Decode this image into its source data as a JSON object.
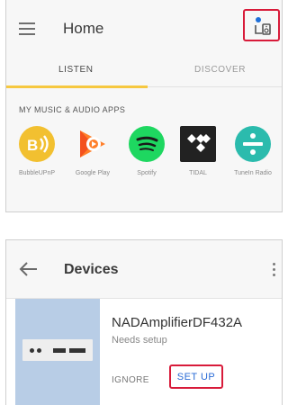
{
  "home": {
    "title": "Home",
    "tabs": [
      {
        "label": "LISTEN",
        "active": true
      },
      {
        "label": "DISCOVER",
        "active": false
      }
    ],
    "accent_color": "#f6c840",
    "section_label": "MY MUSIC & AUDIO APPS",
    "apps": [
      {
        "name": "BubbleUPnP",
        "icon": "bubbleupnp-icon",
        "color": "#f2c030"
      },
      {
        "name": "Google Play",
        "icon": "google-play-music-icon",
        "color": "#ff7f2a"
      },
      {
        "name": "Spotify",
        "icon": "spotify-icon",
        "color": "#1ed760"
      },
      {
        "name": "TIDAL",
        "icon": "tidal-icon",
        "color": "#222222"
      },
      {
        "name": "TuneIn Radio",
        "icon": "tunein-icon",
        "color": "#2bbbad"
      }
    ],
    "devices_button_icon": "devices-speaker-icon",
    "highlight_color": "#d81b3a"
  },
  "devices": {
    "title": "Devices",
    "device": {
      "name": "NADAmplifierDF432A",
      "status": "Needs setup",
      "ignore_label": "IGNORE",
      "setup_label": "SET UP",
      "thumb_color": "#b8cde6"
    }
  }
}
